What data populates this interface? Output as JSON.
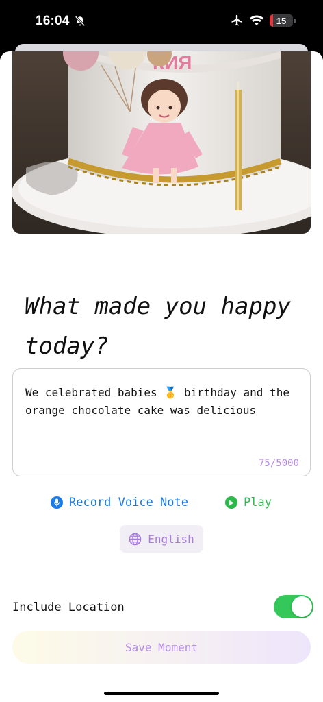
{
  "status_bar": {
    "time": "16:04",
    "battery_percent": "15",
    "battery_level": 0.15,
    "icons": [
      "bell-slash-icon",
      "airplane-icon",
      "wifi-icon",
      "battery-icon"
    ]
  },
  "photo": {
    "cake_topper_text": "КИЯ",
    "icon": "photo-birthday-cake"
  },
  "prompt": {
    "question": "What made you happy today?"
  },
  "entry": {
    "text": "We celebrated babies 🥇 birthday and the orange chocolate cake was delicious",
    "char_count": "75/5000"
  },
  "actions": {
    "record_label": "Record Voice Note",
    "record_icon": "microphone-icon",
    "play_label": "Play",
    "play_icon": "play-circle-icon",
    "language_label": "English",
    "language_icon": "globe-icon"
  },
  "location": {
    "label": "Include Location",
    "enabled": true
  },
  "save": {
    "label": "Save Moment"
  },
  "colors": {
    "accent_blue": "#1a7ae8",
    "accent_green": "#2db84b",
    "accent_purple": "#b48de4",
    "toggle_on": "#34c759"
  }
}
